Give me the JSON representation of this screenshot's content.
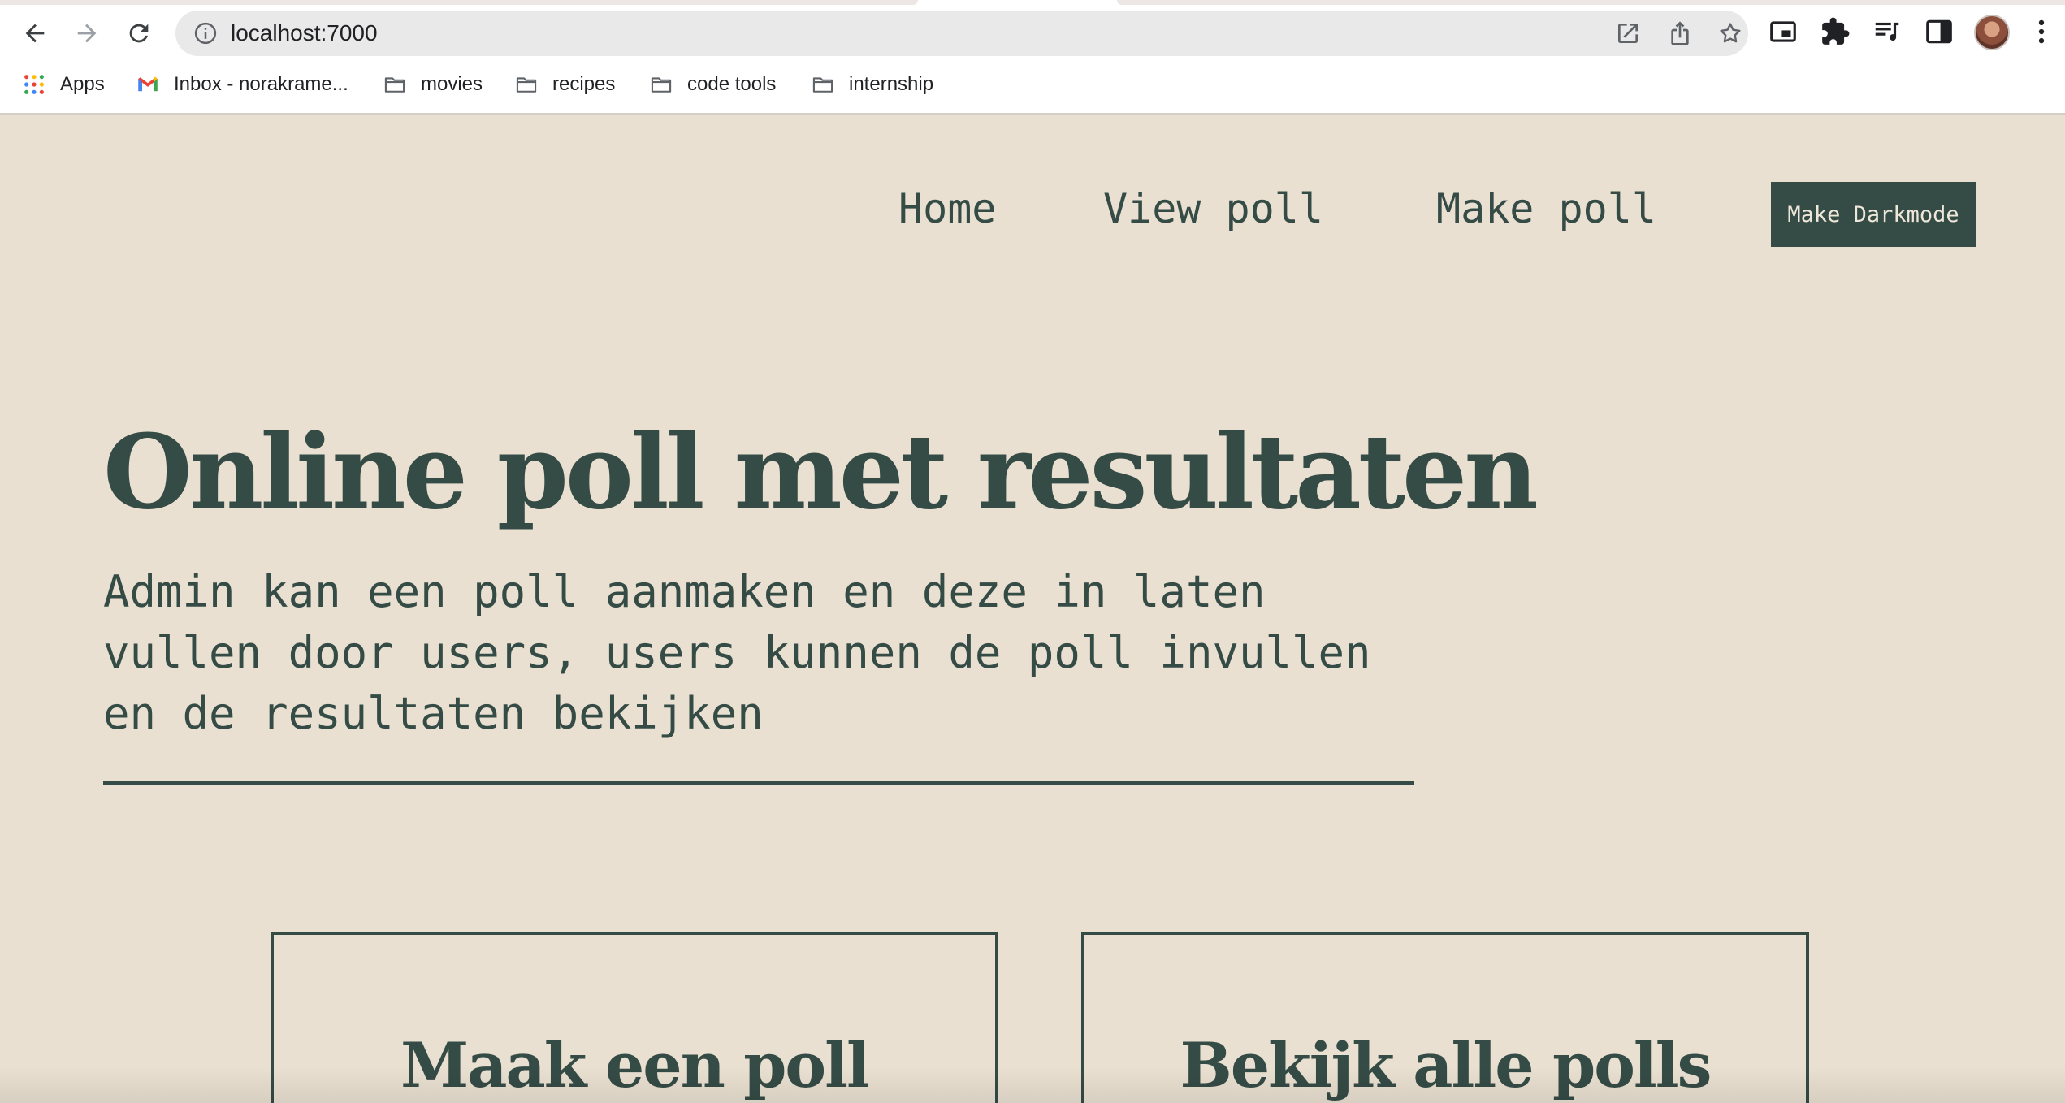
{
  "browser": {
    "url": "localhost:7000",
    "bookmarks": [
      {
        "label": "Apps",
        "icon": "apps-grid-icon"
      },
      {
        "label": "Inbox - norakrame...",
        "icon": "gmail-icon"
      },
      {
        "label": "movies",
        "icon": "folder-icon"
      },
      {
        "label": "recipes",
        "icon": "folder-icon"
      },
      {
        "label": "code tools",
        "icon": "folder-icon"
      },
      {
        "label": "internship",
        "icon": "folder-icon"
      }
    ]
  },
  "site": {
    "nav": {
      "home": "Home",
      "view_poll": "View poll",
      "make_poll": "Make poll",
      "darkmode_button": "Make Darkmode"
    },
    "hero": {
      "title": "Online poll met resultaten",
      "subtitle": "Admin kan een poll aanmaken en deze in laten vullen door users, users kunnen de poll invullen en de resultaten bekijken"
    },
    "cards": [
      {
        "title": "Maak een poll"
      },
      {
        "title": "Bekijk alle polls"
      }
    ]
  },
  "colors": {
    "background": "#e9e0d1",
    "primary": "#354b45",
    "button_text": "#efe7da"
  }
}
